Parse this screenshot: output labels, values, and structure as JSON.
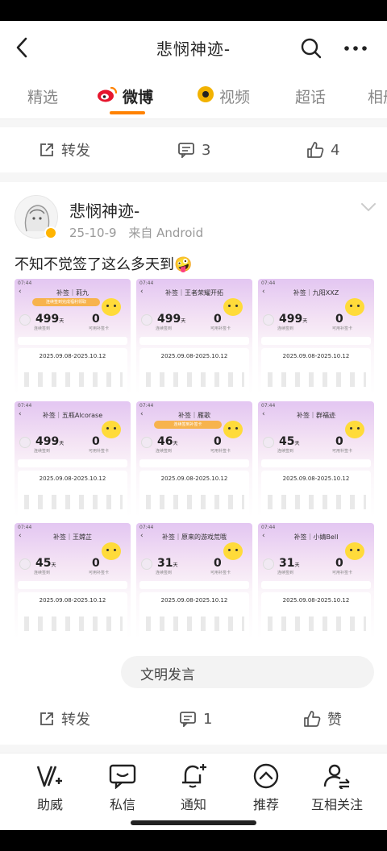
{
  "header": {
    "title": "悲悯神迹-"
  },
  "tabs": [
    {
      "label": "精选"
    },
    {
      "label": "微博"
    },
    {
      "label": "视频"
    },
    {
      "label": "超话"
    },
    {
      "label": "相册"
    }
  ],
  "prev_post_actions": {
    "repost_label": "转发",
    "comment_count": "3",
    "like_count": "4"
  },
  "post": {
    "username": "悲悯神迹-",
    "date": "25-10-9",
    "source": "来自 Android",
    "text": "不知不觉签了这么多天到🤪",
    "images": [
      {
        "title": "补签｜莉九",
        "days": "499",
        "banner": "连续签到完成福利领取"
      },
      {
        "title": "补签｜王者荣耀开拓",
        "days": "499",
        "banner": ""
      },
      {
        "title": "补签｜九阳XXZ",
        "days": "499",
        "banner": ""
      },
      {
        "title": "补签｜五瓶Alcorase",
        "days": "499",
        "banner": ""
      },
      {
        "title": "补签｜雁歌",
        "days": "46",
        "banner": "连续签到补签卡"
      },
      {
        "title": "补签｜群福迹",
        "days": "45",
        "banner": ""
      },
      {
        "title": "补签｜王嫦芷",
        "days": "45",
        "banner": ""
      },
      {
        "title": "补签｜原来的游戏荒哦",
        "days": "31",
        "banner": ""
      },
      {
        "title": "补签｜小婧Bell",
        "days": "31",
        "banner": ""
      }
    ],
    "image_common": {
      "zero": "0",
      "unit": "天",
      "date_range": "2025.09.08-2025.10.12",
      "label_days": "连续签到",
      "label_cards": "可用补签卡",
      "status": "07:44"
    },
    "comment_placeholder": "文明发言",
    "actions": {
      "repost_label": "转发",
      "comment_count": "1",
      "like_label": "赞"
    }
  },
  "bottom_nav": [
    {
      "label": "助威",
      "icon": "cheer-icon"
    },
    {
      "label": "私信",
      "icon": "message-icon"
    },
    {
      "label": "通知",
      "icon": "bell-icon"
    },
    {
      "label": "推荐",
      "icon": "recommend-icon"
    },
    {
      "label": "互相关注",
      "icon": "mutual-follow-icon"
    }
  ],
  "colors": {
    "accent": "#ff8200",
    "badge": "#ffb400"
  }
}
